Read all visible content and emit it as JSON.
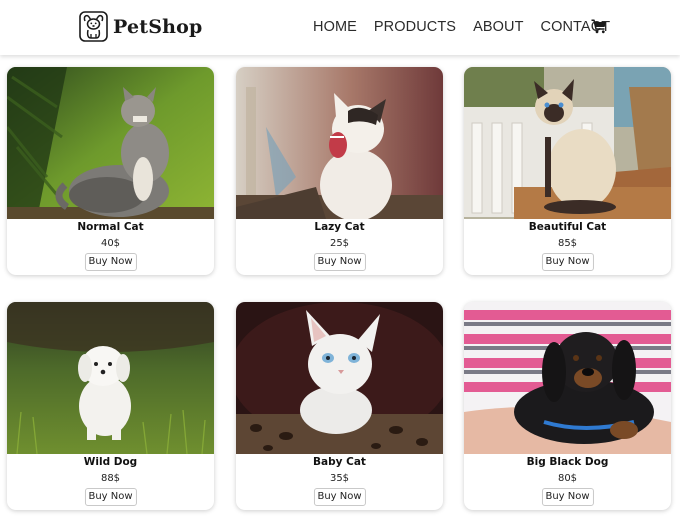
{
  "header": {
    "brand": "PetShop",
    "nav": [
      "HOME",
      "PRODUCTS",
      "ABOUT",
      "CONTACT"
    ],
    "cart_icon": "cart-icon"
  },
  "products": [
    {
      "name": "Normal Cat",
      "price": "40$",
      "buy_label": "Buy Now"
    },
    {
      "name": "Lazy Cat",
      "price": "25$",
      "buy_label": "Buy Now"
    },
    {
      "name": "Beautiful Cat",
      "price": "85$",
      "buy_label": "Buy Now"
    },
    {
      "name": "Wild Dog",
      "price": "88$",
      "buy_label": "Buy Now"
    },
    {
      "name": "Baby Cat",
      "price": "35$",
      "buy_label": "Buy Now"
    },
    {
      "name": "Big Black Dog",
      "price": "80$",
      "buy_label": "Buy Now"
    }
  ]
}
